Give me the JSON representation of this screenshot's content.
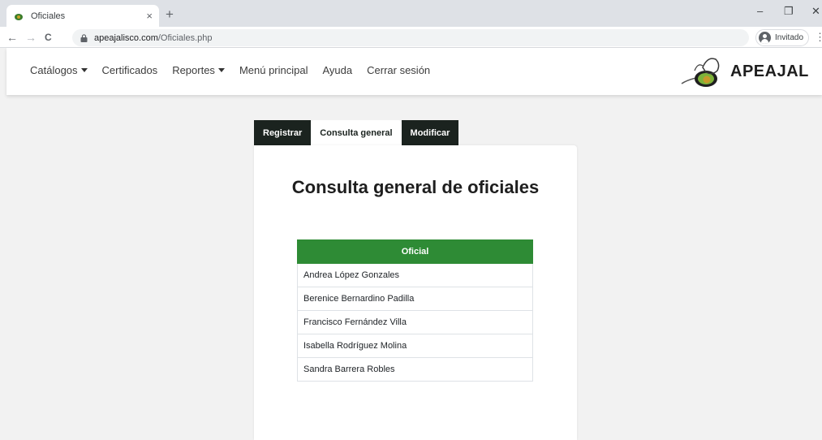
{
  "browser": {
    "tab_title": "Oficiales",
    "tab_close": "×",
    "new_tab": "+",
    "url_host": "apeajalisco.com",
    "url_path": "/Oficiales.php",
    "profile_label": "Invitado",
    "back": "←",
    "forward": "→",
    "reload": "C",
    "minimize": "–",
    "restore": "❐",
    "close": "✕",
    "menu": "⋮"
  },
  "navbar": {
    "items": [
      {
        "label": "Catálogos",
        "dropdown": true
      },
      {
        "label": "Certificados",
        "dropdown": false
      },
      {
        "label": "Reportes",
        "dropdown": true
      },
      {
        "label": "Menú principal",
        "dropdown": false
      },
      {
        "label": "Ayuda",
        "dropdown": false
      },
      {
        "label": "Cerrar sesión",
        "dropdown": false
      }
    ],
    "logo_text": "APEAJAL"
  },
  "tabs": {
    "register": "Registrar",
    "general": "Consulta general",
    "modify": "Modificar",
    "active": "general"
  },
  "main": {
    "title": "Consulta general de oficiales",
    "table_header": "Oficial",
    "rows": [
      "Andrea López Gonzales",
      "Berenice Bernardino Padilla",
      "Francisco Fernández Villa",
      "Isabella Rodríguez Molina",
      "Sandra Barrera Robles"
    ]
  },
  "colors": {
    "accent_green": "#2e8b35",
    "tab_dark": "#1b231f"
  }
}
